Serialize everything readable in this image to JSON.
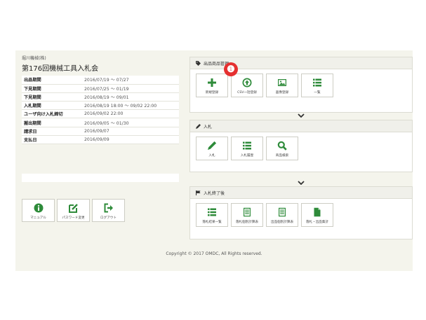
{
  "company": "堀川機械(株)",
  "auction_title": "第176回機械工具入札会",
  "schedule": [
    {
      "label": "出品期間",
      "value": "2016/07/19 ～ 07/27"
    },
    {
      "label": "下見期間",
      "value": "2016/07/25 ～ 01/19"
    },
    {
      "label": "下見期間",
      "value": "2016/08/19 ～ 09/01"
    },
    {
      "label": "入札期間",
      "value": "2016/08/19 18:00 ～ 09/02 22:00"
    },
    {
      "label": "ユーザ向け入札締切",
      "value": "2016/09/02 22:00"
    },
    {
      "label": "搬出期間",
      "value": "2016/09/05 ～ 01/30"
    },
    {
      "label": "請求日",
      "value": "2016/09/07"
    },
    {
      "label": "支払日",
      "value": "2016/09/09"
    }
  ],
  "left_buttons": [
    {
      "label": "マニュアル",
      "icon": "info-icon"
    },
    {
      "label": "パスワード変更",
      "icon": "edit-icon"
    },
    {
      "label": "ログアウト",
      "icon": "logout-icon"
    }
  ],
  "panels": {
    "listing": {
      "title": "出品商品管理",
      "buttons": [
        {
          "label": "新規登録",
          "icon": "plus-icon"
        },
        {
          "label": "CSV一括登録",
          "icon": "upload-icon"
        },
        {
          "label": "画像登録",
          "icon": "image-icon"
        },
        {
          "label": "一覧",
          "icon": "list-icon"
        }
      ]
    },
    "bidding": {
      "title": "入札",
      "buttons": [
        {
          "label": "入札",
          "icon": "pencil-icon"
        },
        {
          "label": "入札履歴",
          "icon": "list-icon"
        },
        {
          "label": "商品検索",
          "icon": "search-icon"
        }
      ]
    },
    "after": {
      "title": "入札終了後",
      "buttons": [
        {
          "label": "落札結果一覧",
          "icon": "list-icon"
        },
        {
          "label": "落札個別計算表",
          "icon": "document-icon"
        },
        {
          "label": "出品個別計算表",
          "icon": "document-icon"
        },
        {
          "label": "落札・出品集計",
          "icon": "file-icon"
        }
      ]
    }
  },
  "badge": "❶",
  "footer": "Copyright © 2017 OMDC, All Rights reserved.",
  "colors": {
    "accent": "#2e8b3a",
    "background": "#f4f4ec",
    "badge": "#e53030"
  }
}
